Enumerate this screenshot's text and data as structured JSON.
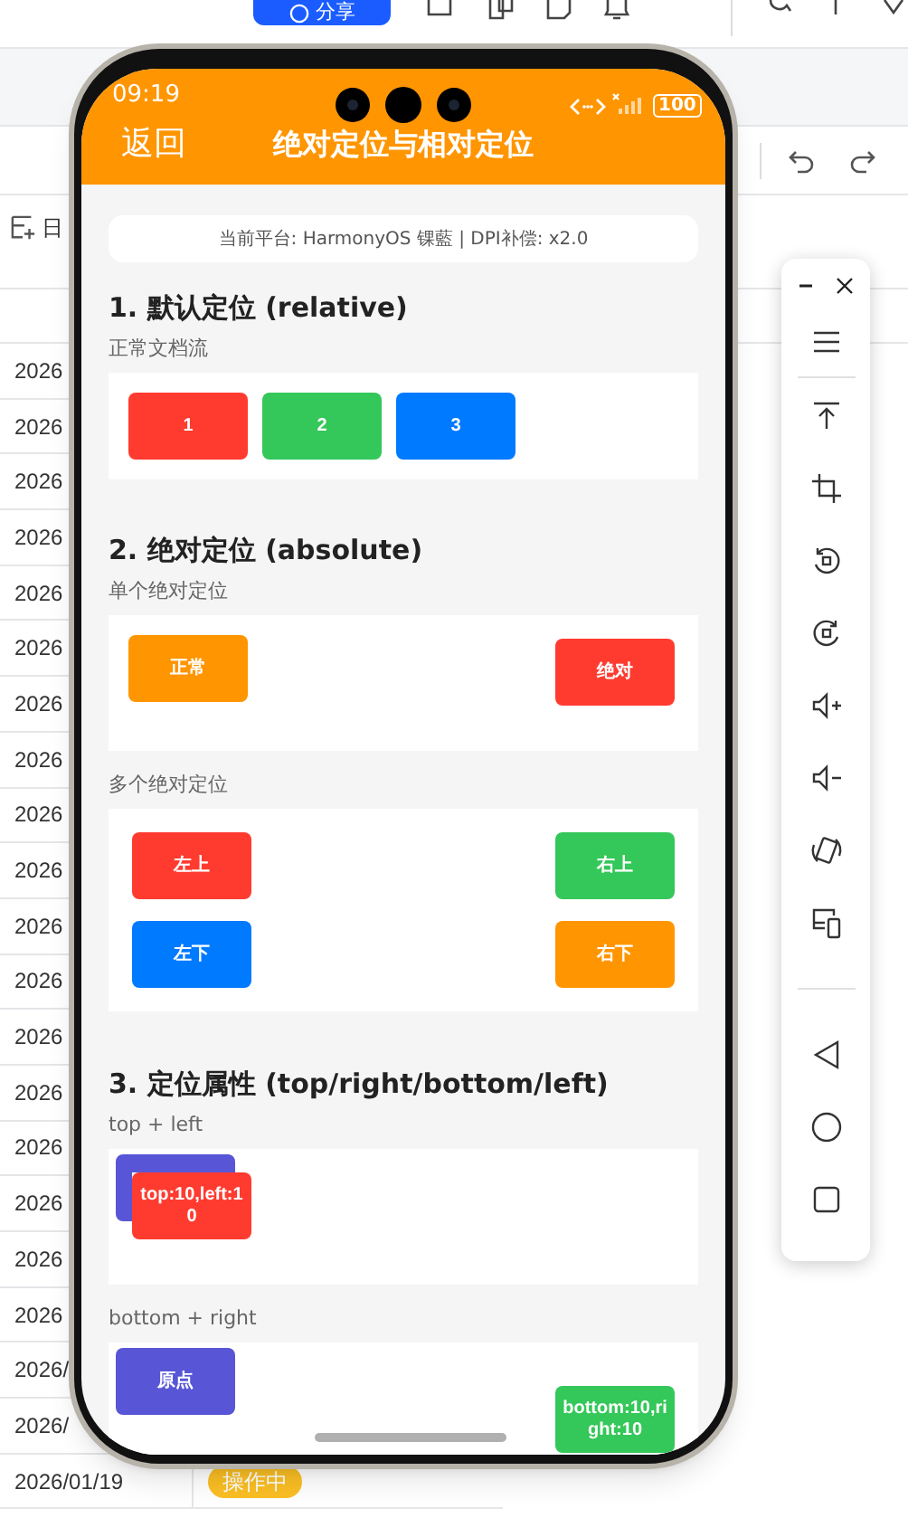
{
  "host": {
    "share_button": "分享",
    "row_label": "日",
    "rows": [
      {
        "date": "2026"
      },
      {
        "date": "2026"
      },
      {
        "date": "2026"
      },
      {
        "date": "2026"
      },
      {
        "date": "2026"
      },
      {
        "date": "2026"
      },
      {
        "date": "2026"
      },
      {
        "date": "2026"
      },
      {
        "date": "2026"
      },
      {
        "date": "2026"
      },
      {
        "date": "2026"
      },
      {
        "date": "2026"
      },
      {
        "date": "2026"
      },
      {
        "date": "2026"
      },
      {
        "date": "2026"
      },
      {
        "date": "2026"
      },
      {
        "date": "2026"
      },
      {
        "date": "2026"
      },
      {
        "date": "2026/"
      },
      {
        "date": "2026/"
      },
      {
        "date": "2026/01/19",
        "status": "操作中"
      }
    ]
  },
  "phone": {
    "status_bar": {
      "time": "09:19",
      "battery": "100"
    },
    "nav": {
      "back": "返回",
      "title": "绝对定位与相对定位"
    },
    "platform": "当前平台: HarmonyOS 锞藍 | DPI补偿: x2.0",
    "sections": [
      {
        "heading": "1. 默认定位 (relative)",
        "demos": [
          {
            "label": "正常文档流",
            "kind": "row",
            "boxes": [
              {
                "text": "1",
                "color": "#ff3b30"
              },
              {
                "text": "2",
                "color": "#34c759"
              },
              {
                "text": "3",
                "color": "#007aff"
              }
            ]
          }
        ]
      },
      {
        "heading": "2. 绝对定位 (absolute)",
        "demos": [
          {
            "label": "单个绝对定位",
            "kind": "single",
            "boxes": [
              {
                "text": "正常",
                "color": "#ff9500"
              },
              {
                "text": "绝对",
                "color": "#ff3b30"
              }
            ]
          },
          {
            "label": "多个绝对定位",
            "kind": "corners",
            "boxes": [
              {
                "text": "左上",
                "color": "#ff3b30"
              },
              {
                "text": "右上",
                "color": "#34c759"
              },
              {
                "text": "左下",
                "color": "#007aff"
              },
              {
                "text": "右下",
                "color": "#ff9500"
              }
            ]
          }
        ]
      },
      {
        "heading": "3. 定位属性 (top/right/bottom/left)",
        "demos": [
          {
            "label": "top + left",
            "kind": "top_left",
            "boxes": [
              {
                "color": "#5856d6"
              },
              {
                "text": "top:10,left:10",
                "color": "#ff3b30"
              }
            ]
          },
          {
            "label": "bottom + right",
            "kind": "bottom_right",
            "boxes": [
              {
                "text": "原点",
                "color": "#5856d6"
              },
              {
                "text": "bottom:10,right:10",
                "color": "#34c759"
              }
            ]
          }
        ]
      }
    ]
  }
}
